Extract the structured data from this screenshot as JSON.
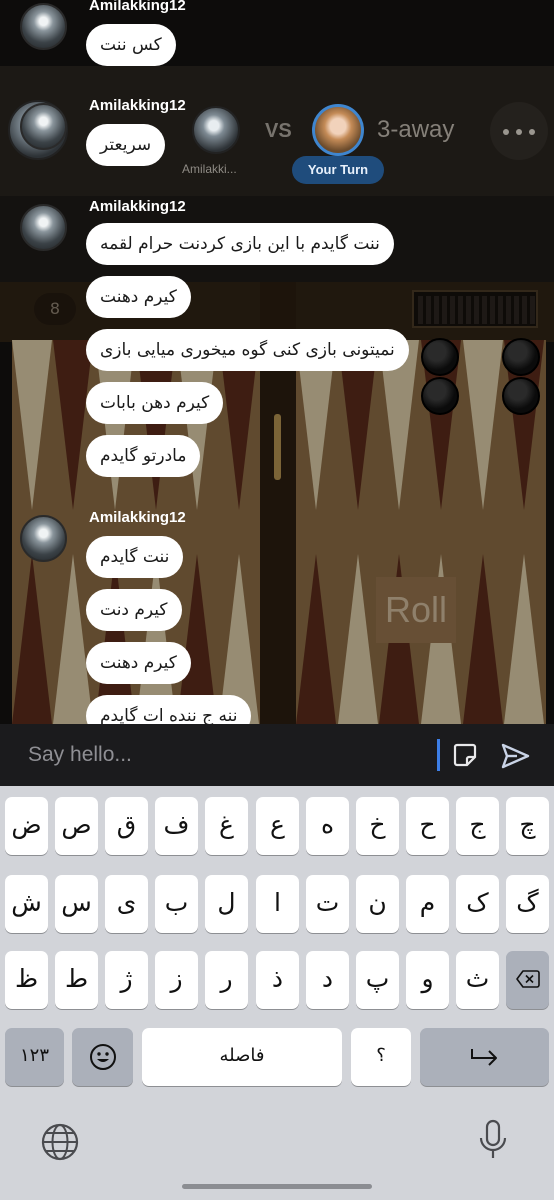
{
  "game": {
    "opponent_name": "Amilakki...",
    "vs_label": "VS",
    "match_label": "3-away",
    "turn_badge": "Your Turn",
    "pip_count": "8",
    "roll_label": "Roll",
    "colors": {
      "board_light": "#d8c9a5",
      "board_dark": "#5a2a1a",
      "wood": "#8a6a44",
      "turn_badge": "#1f4c7c"
    }
  },
  "chat": {
    "groups": [
      {
        "user": "Amilakking12",
        "messages": [
          "کس ننت"
        ]
      },
      {
        "user": "Amilakking12",
        "messages": [
          "سریعتر"
        ]
      },
      {
        "user": "Amilakking12",
        "messages": [
          "ننت گایدم با این بازی کردنت حرام لقمه",
          "کیرم دهنت",
          "نمیتونی بازی کنی گوه میخوری میایی بازی",
          "کیرم دهن بابات",
          "مادرتو گایدم"
        ]
      },
      {
        "user": "Amilakking12",
        "messages": [
          "ننت گایدم",
          "کیرم دنت",
          "کیرم دهنت",
          "ننه ج ننده ات گایدم"
        ]
      }
    ]
  },
  "input": {
    "placeholder": "Say hello..."
  },
  "keyboard": {
    "row1": [
      "ض",
      "ص",
      "ق",
      "ف",
      "غ",
      "ع",
      "ه",
      "خ",
      "ح",
      "ج",
      "چ"
    ],
    "row2": [
      "ش",
      "س",
      "ی",
      "ب",
      "ل",
      "ا",
      "ت",
      "ن",
      "م",
      "ک",
      "گ"
    ],
    "row3": [
      "ظ",
      "ط",
      "ژ",
      "ز",
      "ر",
      "ذ",
      "د",
      "پ",
      "و",
      "ث"
    ],
    "numbers_key": "۱۲۳",
    "space_label": "فاصله",
    "period_key": "؟",
    "accent_color": "#3d7ee6"
  }
}
